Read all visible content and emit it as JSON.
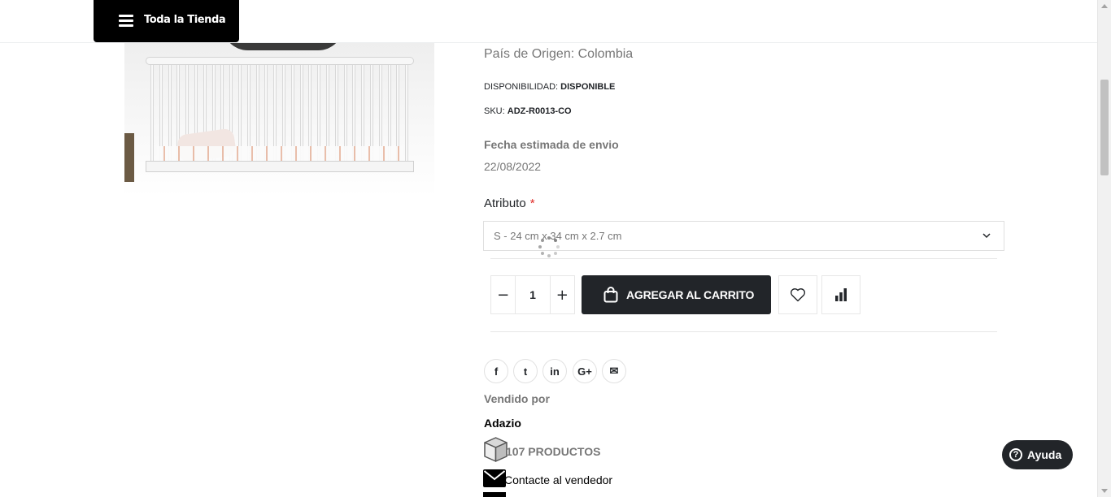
{
  "header": {
    "store_button_label": "Toda la Tienda"
  },
  "product": {
    "origin": "País de Origen: Colombia",
    "availability_label": "DISPONIBILIDAD:",
    "availability_value": "DISPONIBLE",
    "sku_label": "SKU:",
    "sku_value": "ADZ-R0013-CO",
    "ship_label": "Fecha estimada de envio",
    "ship_date": "22/08/2022",
    "attribute_label": "Atributo",
    "attribute_required_mark": "*",
    "attribute_selected": "S - 24 cm x 34 cm x 2.7 cm"
  },
  "cart": {
    "quantity": "1",
    "decrement_label": "−",
    "increment_label": "+",
    "add_to_cart_label": "AGREGAR AL CARRITO"
  },
  "share": {
    "items": [
      {
        "name": "facebook",
        "glyph": "f"
      },
      {
        "name": "twitter",
        "glyph": "t"
      },
      {
        "name": "linkedin",
        "glyph": "in"
      },
      {
        "name": "google-plus",
        "glyph": "G+"
      },
      {
        "name": "email",
        "glyph": "✉"
      }
    ]
  },
  "vendor": {
    "sold_by_label": "Vendido por",
    "name": "Adazio",
    "products_count": "107 PRODUCTOS",
    "contact_label": "Contacte al vendedor"
  },
  "help": {
    "label": "Ayuda",
    "glyph": "?"
  },
  "colors": {
    "dark": "#222529",
    "muted": "#777777",
    "required": "#e02b27",
    "border": "#e7e7e7"
  }
}
